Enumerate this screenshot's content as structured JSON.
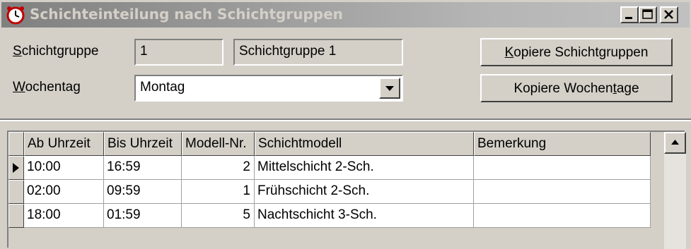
{
  "window": {
    "title": "Schichteinteilung nach Schichtgruppen",
    "icon": "clock-icon",
    "controls": [
      "minimize-icon",
      "maximize-icon",
      "close-icon"
    ]
  },
  "form": {
    "schichtgruppe": {
      "label_mnemonic": "S",
      "label_rest": "chichtgruppe",
      "number": "1",
      "name": "Schichtgruppe 1"
    },
    "wochentag": {
      "label_mnemonic": "W",
      "label_rest": "ochentag",
      "value": "Montag"
    }
  },
  "buttons": {
    "kopiere_schichtgruppen": {
      "mnemonic": "K",
      "rest": "opiere Schichtgruppen"
    },
    "kopiere_wochentage": {
      "before": "Kopiere Wochen",
      "mnemonic": "t",
      "after": "age"
    }
  },
  "table": {
    "columns": [
      "Ab Uhrzeit",
      "Bis Uhrzeit",
      "Modell-Nr.",
      "Schichtmodell",
      "Bemerkung"
    ],
    "rows": [
      [
        "10:00",
        "16:59",
        "2",
        "Mittelschicht 2-Sch.",
        ""
      ],
      [
        "02:00",
        "09:59",
        "1",
        "Frühschicht 2-Sch.",
        ""
      ],
      [
        "18:00",
        "01:59",
        "5",
        "Nachtschicht 3-Sch.",
        ""
      ]
    ],
    "current_row": 0
  }
}
